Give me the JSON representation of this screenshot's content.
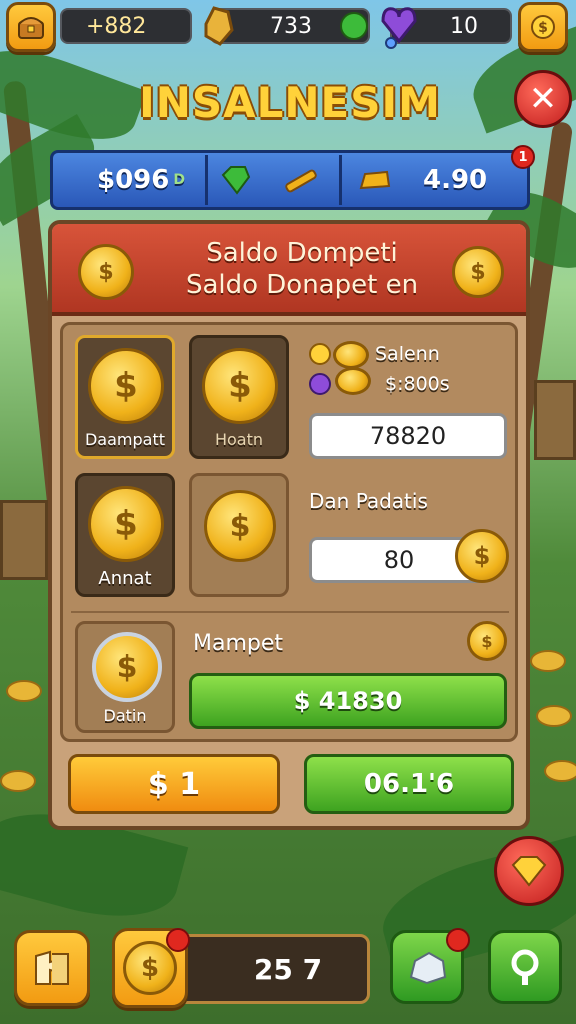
{
  "topbar": {
    "menu_icon": "treasure-chest-icon",
    "currency1_value": "+882",
    "currency2_icon": "gold-nugget-icon",
    "currency2_value": "733",
    "currency2_badge_icon": "green-gem-icon",
    "currency3_icon": "purple-heart-gem-icon",
    "currency3_value": "10",
    "shop_icon": "coin-stack-icon"
  },
  "title": "INSALNESIM",
  "close_icon": "close-icon",
  "stats": {
    "money": "$096",
    "money_suffix": "D",
    "item1_icon": "green-gem-icon",
    "item2_icon": "golden-key-icon",
    "item3_icon": "gold-bar-icon",
    "value": "4.90",
    "badge": "1"
  },
  "panel": {
    "header_line1": "Saldo Dompeti",
    "header_line2": "Saldo Donapet en",
    "slots": [
      {
        "label": "Daampatt",
        "selected": true
      },
      {
        "label": "Hoatn",
        "selected": false
      },
      {
        "label": "Annat",
        "selected": false
      },
      {
        "label": "",
        "selected": false
      },
      {
        "label": "Datin",
        "selected": false
      }
    ],
    "balance_label1": "Salenn",
    "balance_label2": "$:800s",
    "balance_field": "78820",
    "section_label": "Dan Padatis",
    "amount_field": "80",
    "mampet_label": "Mampet",
    "total_bar": "$ 41830",
    "orange_button": "$ 1",
    "green_button": "06.1'6"
  },
  "bottom": {
    "map_icon": "puzzle-map-icon",
    "coin_icon": "coin-icon",
    "coin_value": "25 7",
    "gift_icon": "rock-gift-icon",
    "search_icon": "search-icon",
    "diamond_icon": "diamond-icon"
  },
  "colors": {
    "gold": "#ffd23a",
    "blue_strip": "#2a58b8",
    "panel_header": "#b03622",
    "green": "#3ea320",
    "orange": "#f08c10",
    "red": "#c21e1e"
  }
}
